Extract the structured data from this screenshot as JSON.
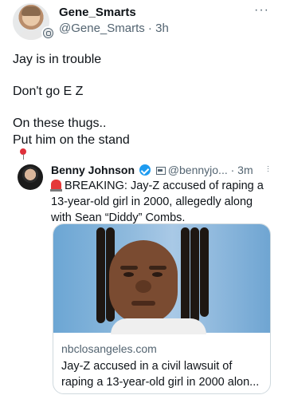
{
  "author": {
    "name": "Gene_Smarts",
    "handle_line": "@Gene_Smarts · 3h",
    "more_label": "···"
  },
  "tweet": {
    "lines": [
      "Jay is in trouble",
      "Don't go E  Z",
      "On these thugs..",
      "Put him on the stand"
    ],
    "emoji_icon": "round-pushpin-icon"
  },
  "quoted": {
    "name": "Benny Johnson",
    "handle_line": "@bennyjo... · 3m",
    "text": "BREAKING: Jay-Z accused of raping a 13-year-old girl in 2000, allegedly along with Sean “Diddy” Combs.",
    "card": {
      "domain": "nbclosangeles.com",
      "title": "Jay-Z accused in a civil lawsuit of raping a 13-year-old girl in 2000 alon..."
    }
  },
  "colors": {
    "text": "#0f1419",
    "secondary": "#536471",
    "verified": "#1d9bf0",
    "border": "#cfd9de",
    "pin": "#e0313b"
  }
}
